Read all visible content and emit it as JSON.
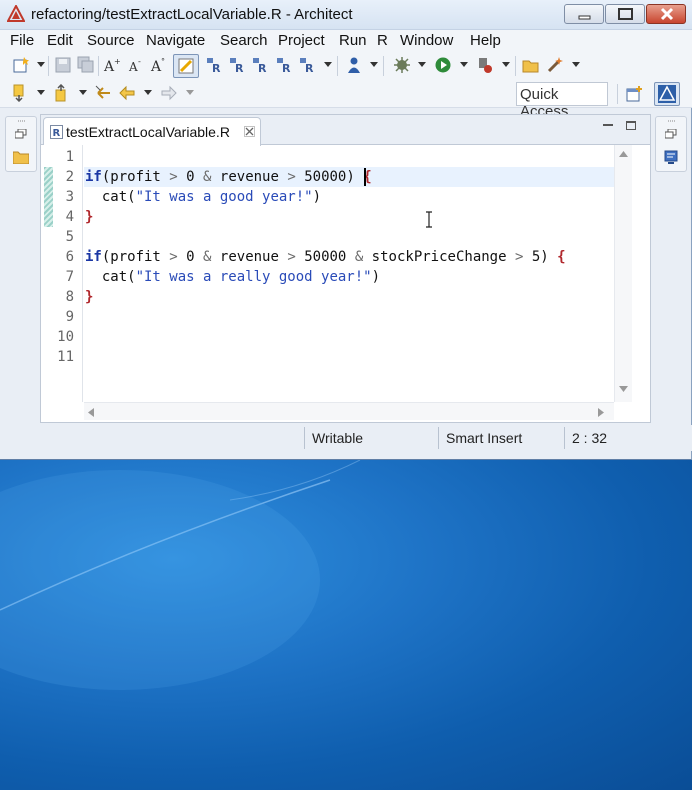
{
  "window": {
    "title": "refactoring/testExtractLocalVariable.R - Architect"
  },
  "menu": {
    "items": [
      "File",
      "Edit",
      "Source",
      "Navigate",
      "Search",
      "Project",
      "Run",
      "R",
      "Window",
      "Help"
    ]
  },
  "toolbar": {
    "quick_access": "Quick Access",
    "row1_icons": [
      "new-wizard-icon",
      "save-icon",
      "save-all-icon",
      "increase-font-icon",
      "decrease-font-icon",
      "font-style-icon",
      "toggle-highlight-icon",
      "r-console-icon",
      "r-console-alt-icon",
      "r-script-icon",
      "r-source-icon",
      "r-run-icon",
      "debug-person-icon",
      "build-icon",
      "run-icon",
      "external-tools-icon",
      "open-folder-icon",
      "wand-icon"
    ],
    "row2_icons": [
      "next-annotation-icon",
      "previous-annotation-icon",
      "last-edit-icon",
      "back-icon",
      "forward-icon"
    ],
    "perspective_icons": [
      "open-perspective-icon",
      "architect-perspective-icon"
    ]
  },
  "editor": {
    "tab_label": "testExtractLocalVariable.R",
    "line_numbers": [
      "1",
      "2",
      "3",
      "4",
      "5",
      "6",
      "7",
      "8",
      "9",
      "10",
      "11"
    ],
    "current_line": 2,
    "changed_lines": [
      2,
      3,
      4
    ],
    "lines": [
      "",
      "if(profit > 0 & revenue > 50000) {",
      "  cat(\"It was a good year!\")",
      "}",
      "",
      "if(profit > 0 & revenue > 50000 & stockPriceChange > 5) {",
      "  cat(\"It was a really good year!\")",
      "}",
      "",
      "",
      ""
    ]
  },
  "status": {
    "writable": "Writable",
    "insert_mode": "Smart Insert",
    "position": "2 : 32"
  },
  "colors": {
    "keyword": "#1a36a4",
    "brace": "#b0272c",
    "string": "#2a4bb8",
    "current_line": "#e8f2fe",
    "desktop": "#1e73c6"
  }
}
